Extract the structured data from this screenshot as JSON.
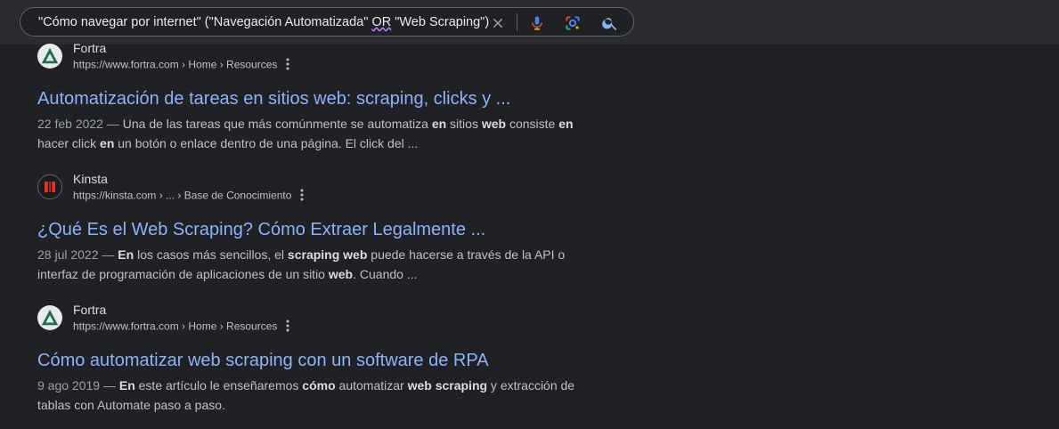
{
  "search": {
    "query_pre": "\"Cómo navegar por internet\" (\"Navegación Automatizada\" ",
    "query_or": "OR",
    "query_post": " \"Web Scraping\")"
  },
  "results": [
    {
      "site_name": "Fortra",
      "url": "https://www.fortra.com › Home › Resources",
      "title": "Automatización de tareas en sitios web: scraping, clicks y ...",
      "date": "22 feb 2022 —",
      "snippet": [
        {
          "t": " Una de las tareas que más comúnmente se automatiza "
        },
        {
          "b": "en"
        },
        {
          "t": " sitios "
        },
        {
          "b": "web"
        },
        {
          "t": " consiste "
        },
        {
          "b": "en"
        },
        {
          "t": " hacer click "
        },
        {
          "b": "en"
        },
        {
          "t": " un botón o enlace dentro de una página. El click del ..."
        }
      ]
    },
    {
      "site_name": "Kinsta",
      "url": "https://kinsta.com › ... › Base de Conocimiento",
      "title": "¿Qué Es el Web Scraping? Cómo Extraer Legalmente ...",
      "date": "28 jul 2022 —",
      "snippet": [
        {
          "t": " "
        },
        {
          "b": "En"
        },
        {
          "t": " los casos más sencillos, el "
        },
        {
          "b": "scraping web"
        },
        {
          "t": " puede hacerse a través de la API o interfaz de programación de aplicaciones de un sitio "
        },
        {
          "b": "web"
        },
        {
          "t": ". Cuando ..."
        }
      ]
    },
    {
      "site_name": "Fortra",
      "url": "https://www.fortra.com › Home › Resources",
      "title": "Cómo automatizar web scraping con un software de RPA",
      "date": "9 ago 2019 —",
      "snippet": [
        {
          "t": " "
        },
        {
          "b": "En"
        },
        {
          "t": " este artículo le enseñaremos "
        },
        {
          "b": "cómo"
        },
        {
          "t": " automatizar "
        },
        {
          "b": "web scraping"
        },
        {
          "t": " y extracción de tablas con Automate paso a paso."
        }
      ]
    }
  ],
  "colors": {
    "background": "#202124",
    "link": "#8ab4f8",
    "fortra_green": "#1f6f50",
    "kinsta_red": "#e8361f"
  },
  "icons": {
    "clear": "close-icon",
    "mic": "microphone-icon",
    "lens": "google-lens-icon",
    "search": "search-icon",
    "more": "more-vert-icon"
  }
}
